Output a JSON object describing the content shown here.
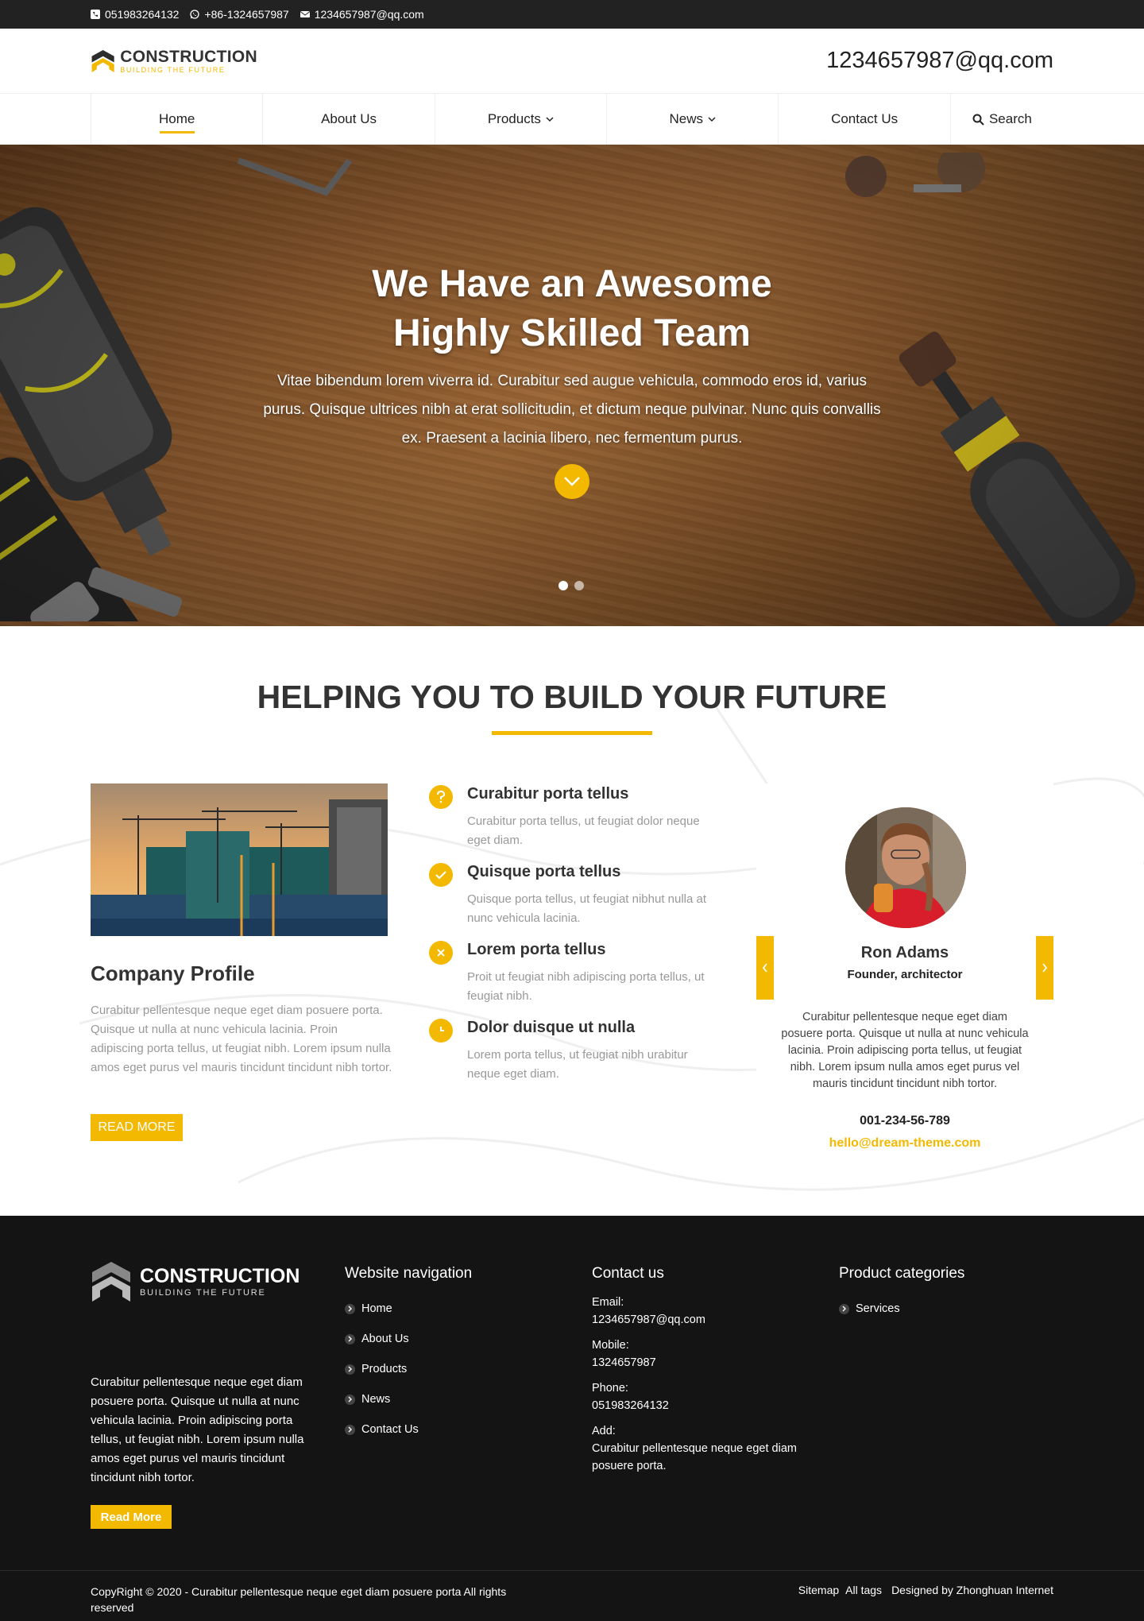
{
  "topbar": {
    "phone": "051983264132",
    "whatsapp": "+86-1324657987",
    "email": "1234657987@qq.com"
  },
  "header": {
    "logo_title": "CONSTRUCTION",
    "logo_tagline": "BUILDING THE FUTURE",
    "email": "1234657987@qq.com"
  },
  "nav": {
    "items": [
      {
        "label": "Home"
      },
      {
        "label": "About Us"
      },
      {
        "label": "Products"
      },
      {
        "label": "News"
      },
      {
        "label": "Contact Us"
      },
      {
        "label": "Search"
      }
    ]
  },
  "hero": {
    "title_line1": "We Have an Awesome",
    "title_line2": "Highly Skilled Team",
    "subtitle": "Vitae bibendum lorem viverra id. Curabitur sed augue vehicula, commodo eros id, varius purus. Quisque ultrices nibh at erat sollicitudin, et dictum neque pulvinar. Nunc quis convallis ex. Praesent a lacinia libero, nec fermentum purus."
  },
  "section": {
    "title": "HELPING YOU TO BUILD YOUR FUTURE",
    "profile_title": "Company Profile",
    "profile_text": "Curabitur pellentesque neque eget diam posuere porta. Quisque ut nulla at nunc vehicula lacinia. Proin adipiscing porta tellus, ut feugiat nibh. Lorem ipsum nulla amos eget purus vel mauris tincidunt tincidunt nibh tortor.",
    "read_more": "READ MORE",
    "features": [
      {
        "title": "Curabitur porta tellus",
        "text": "Curabitur porta tellus, ut feugiat dolor neque eget diam."
      },
      {
        "title": "Quisque porta tellus",
        "text": "Quisque porta tellus, ut feugiat nibhut nulla at nunc vehicula lacinia."
      },
      {
        "title": "Lorem porta tellus",
        "text": "Proit ut feugiat nibh adipiscing porta tellus, ut feugiat nibh."
      },
      {
        "title": "Dolor duisque ut nulla",
        "text": "Lorem porta tellus, ut feugiat nibh urabitur neque eget diam."
      }
    ],
    "team": {
      "name": "Ron Adams",
      "role": "Founder, architector",
      "text": "Curabitur pellentesque neque eget diam posuere porta. Quisque ut nulla at nunc vehicula lacinia. Proin adipiscing porta tellus, ut feugiat nibh. Lorem ipsum nulla amos eget purus vel mauris tincidunt tincidunt nibh tortor.",
      "phone": "001-234-56-789",
      "email": "hello@dream-theme.com"
    }
  },
  "footer": {
    "logo_title": "CONSTRUCTION",
    "logo_tagline": "BUILDING THE FUTURE",
    "about": "Curabitur pellentesque neque eget diam posuere porta. Quisque ut nulla at nunc vehicula lacinia. Proin adipiscing porta tellus, ut feugiat nibh. Lorem ipsum nulla amos eget purus vel mauris tincidunt tincidunt nibh tortor.",
    "read_more": "Read More",
    "nav_heading": "Website navigation",
    "nav_links": [
      "Home",
      "About Us",
      "Products",
      "News",
      "Contact Us"
    ],
    "contact_heading": "Contact us",
    "contact": {
      "email_label": "Email:",
      "email": "1234657987@qq.com",
      "mobile_label": "Mobile:",
      "mobile": "1324657987",
      "phone_label": "Phone:",
      "phone": "051983264132",
      "add_label": "Add:",
      "add": "Curabitur pellentesque neque eget diam posuere porta."
    },
    "products_heading": "Product categories",
    "product_links": [
      "Services"
    ],
    "copyright": "CopyRight © 2020 -   Curabitur pellentesque neque eget diam posuere porta  All rights reserved",
    "sitemap": "Sitemap",
    "all_tags": "All tags",
    "designed_by": "Designed by Zhonghuan Internet"
  },
  "colors": {
    "accent": "#f3b800",
    "dark": "#222222",
    "footer_bg": "#141414"
  },
  "icons": [
    "phone-icon",
    "whatsapp-icon",
    "envelope-icon",
    "chevron-down-icon",
    "search-icon",
    "question-icon",
    "check-icon",
    "close-icon",
    "clock-icon",
    "chevron-left-icon",
    "chevron-right-icon",
    "chevron-right-small-icon"
  ]
}
